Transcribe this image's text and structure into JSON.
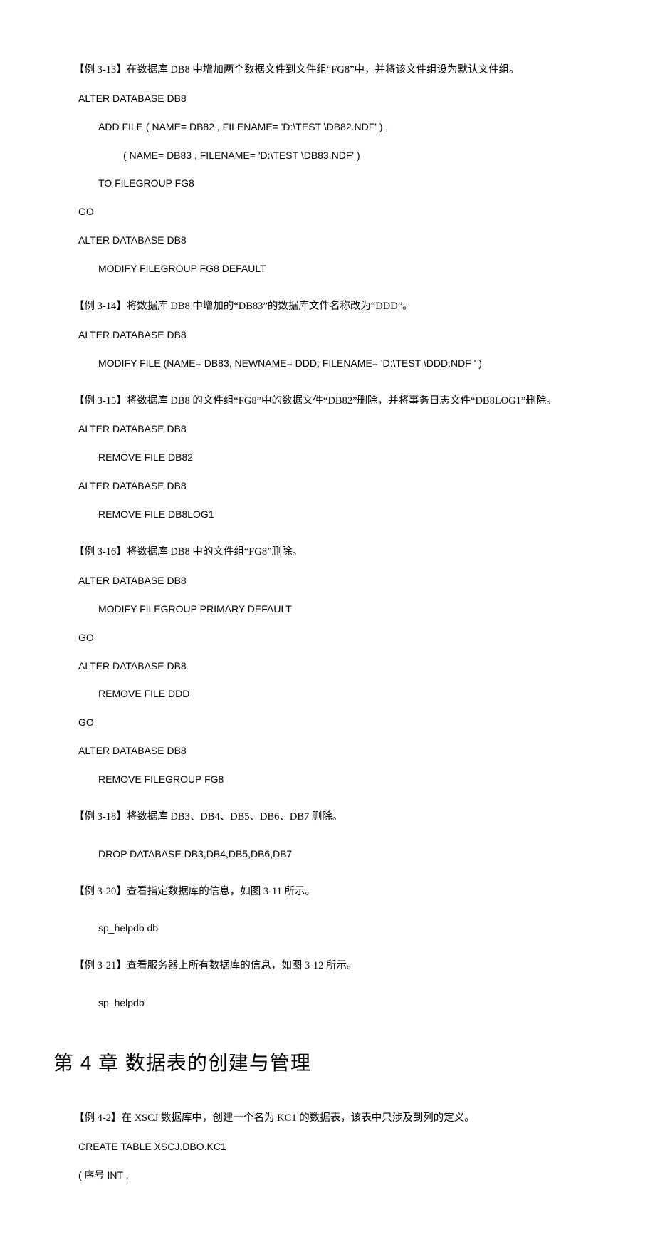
{
  "ex313": {
    "title": "【例 3-13】在数据库 DB8 中增加两个数据文件到文件组“FG8”中，并将该文件组设为默认文件组。",
    "lines": [
      "ALTER   DATABASE   DB8",
      "ADD    FILE ( NAME= DB82 ,    FILENAME= 'D:\\TEST \\DB82.NDF' ) ,",
      "( NAME= DB83 ,    FILENAME= 'D:\\TEST \\DB83.NDF' )",
      "TO   FILEGROUP   FG8",
      "GO",
      "ALTER   DATABASE   DB8",
      "MODIFY   FILEGROUP   FG8   DEFAULT"
    ]
  },
  "ex314": {
    "title": "【例 3-14】将数据库 DB8 中增加的“DB83”的数据库文件名称改为“DDD”。",
    "lines": [
      "ALTER   DATABASE   DB8",
      "MODIFY    FILE (NAME= DB83, NEWNAME= DDD, FILENAME= 'D:\\TEST \\DDD.NDF ' )"
    ]
  },
  "ex315": {
    "title": "【例 3-15】将数据库 DB8 的文件组“FG8”中的数据文件“DB82”删除，并将事务日志文件“DB8LOG1”删除。",
    "lines": [
      "ALTER   DATABASE   DB8",
      "REMOVE   FILE   DB82",
      "ALTER   DATABASE   DB8",
      "REMOVE   FILE   DB8LOG1"
    ]
  },
  "ex316": {
    "title": "【例 3-16】将数据库 DB8 中的文件组“FG8”删除。",
    "lines": [
      "ALTER   DATABASE   DB8",
      "MODIFY   FILEGROUP   PRIMARY   DEFAULT",
      "GO",
      "ALTER   DATABASE   DB8",
      "REMOVE   FILE   DDD",
      "GO",
      "ALTER   DATABASE   DB8",
      "REMOVE   FILEGROUP   FG8"
    ]
  },
  "ex318": {
    "title": "【例 3-18】将数据库 DB3、DB4、DB5、DB6、DB7 删除。",
    "lines": [
      "DROP   DATABASE   DB3,DB4,DB5,DB6,DB7"
    ]
  },
  "ex320": {
    "title": "【例 3-20】查看指定数据库的信息，如图 3-11 所示。",
    "lines": [
      "sp_helpdb   db"
    ]
  },
  "ex321": {
    "title": "【例 3-21】查看服务器上所有数据库的信息，如图 3-12 所示。",
    "lines": [
      "sp_helpdb"
    ]
  },
  "chapter4": {
    "title": "第 4 章    数据表的创建与管理"
  },
  "ex42": {
    "title": "【例 4-2】在 XSCJ 数据库中，创建一个名为 KC1 的数据表，该表中只涉及到列的定义。",
    "lines": [
      "CREATE   TABLE   XSCJ.DBO.KC1",
      "(  序号            INT ,"
    ]
  }
}
